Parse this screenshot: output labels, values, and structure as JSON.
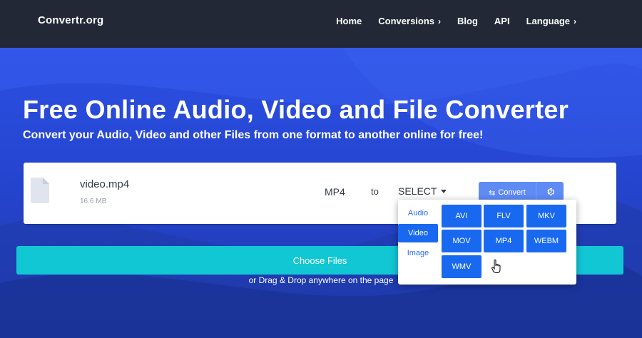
{
  "nav": {
    "brand": "Convertr.org",
    "links": [
      {
        "label": "Home",
        "has_chevron": false
      },
      {
        "label": "Conversions",
        "has_chevron": true
      },
      {
        "label": "Blog",
        "has_chevron": false
      },
      {
        "label": "API",
        "has_chevron": false
      },
      {
        "label": "Language",
        "has_chevron": true
      }
    ],
    "chevron_glyph": "›"
  },
  "hero": {
    "title": "Free Online Audio, Video and File Converter",
    "subtitle": "Convert your Audio, Video and other Files from one format to another online for free!"
  },
  "file": {
    "name": "video.mp4",
    "size": "16.6 MB",
    "from_format": "MP4",
    "to_label": "to",
    "select_label": "SELECT",
    "convert_label": "Convert",
    "icons": {
      "file": "file-icon",
      "swap": "swap-icon",
      "settings": "gear-icon"
    }
  },
  "upload": {
    "choose_label": "Choose Files",
    "drag_text": "or Drag & Drop anywhere on the page"
  },
  "format_panel": {
    "categories": [
      {
        "label": "Audio",
        "active": false
      },
      {
        "label": "Video",
        "active": true
      },
      {
        "label": "Image",
        "active": false
      }
    ],
    "formats": [
      "AVI",
      "FLV",
      "MKV",
      "MOV",
      "MP4",
      "WEBM",
      "WMV"
    ]
  },
  "colors": {
    "navbar": "#222836",
    "hero_blue": "#2c50e4",
    "convert_button": "#5f8bf5",
    "choose_button": "#11c7d4",
    "format_button": "#1969f0"
  }
}
